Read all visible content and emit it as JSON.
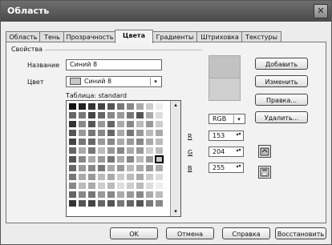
{
  "window": {
    "title": "Область",
    "close_glyph": "✕"
  },
  "tabs": [
    {
      "label": "Область"
    },
    {
      "label": "Тень"
    },
    {
      "label": "Прозрачность"
    },
    {
      "label": "Цвета"
    },
    {
      "label": "Градиенты"
    },
    {
      "label": "Штриховка"
    },
    {
      "label": "Текстуры"
    }
  ],
  "properties": {
    "legend": "Свойства",
    "name_label": "Название",
    "name_value": "Синий 8",
    "color_label": "Цвет",
    "color_value": "Синий 8",
    "table_label": "Таблица: standard"
  },
  "color_model": {
    "value": "RGB"
  },
  "rgb": {
    "r_label": "R",
    "r_value": "153",
    "g_label": "G",
    "g_value": "204",
    "b_label": "B",
    "b_value": "255"
  },
  "side_buttons": {
    "add": "Добавить",
    "change": "Изменить",
    "edit": "Правка...",
    "delete": "Удалить..."
  },
  "footer": {
    "ok": "OK",
    "cancel": "Отмена",
    "help": "Справка",
    "restore": "Восстановить"
  },
  "icons": {
    "dropdown": "▾",
    "scroll_up": "▴",
    "scroll_down": "▾",
    "spin": "▴▾"
  }
}
